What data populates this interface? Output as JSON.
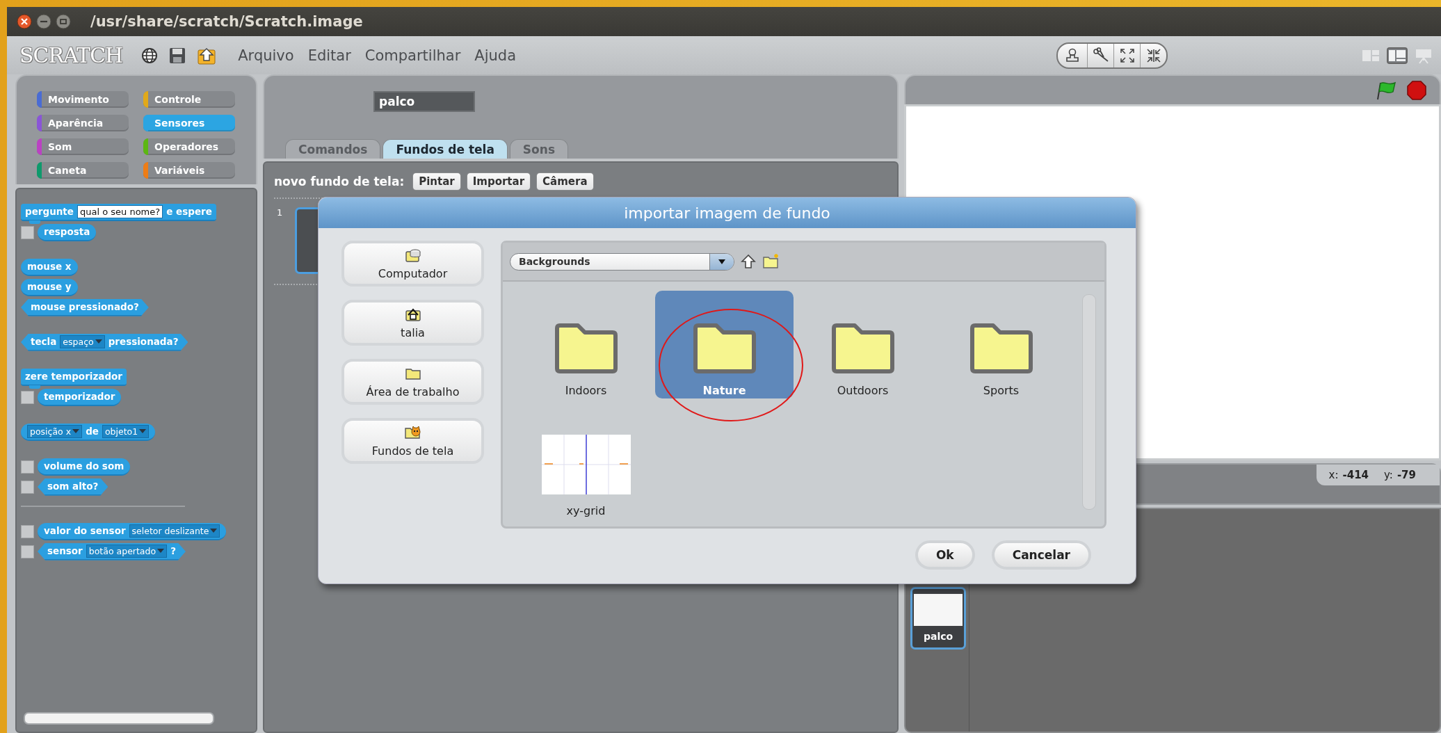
{
  "window": {
    "title": "/usr/share/scratch/Scratch.image"
  },
  "menu_bar": {
    "logo": "SCRATCH",
    "menus": [
      "Arquivo",
      "Editar",
      "Compartilhar",
      "Ajuda"
    ]
  },
  "view_modes": [
    {
      "selected": false
    },
    {
      "selected": true
    },
    {
      "selected": false
    }
  ],
  "categories": [
    {
      "label": "Movimento",
      "color": "#4a6cd4",
      "selected": false
    },
    {
      "label": "Controle",
      "color": "#e1a91a",
      "selected": false
    },
    {
      "label": "Aparência",
      "color": "#8a55d7",
      "selected": false
    },
    {
      "label": "Sensores",
      "color": "#2ca5e2",
      "selected": true
    },
    {
      "label": "Som",
      "color": "#bb42c3",
      "selected": false
    },
    {
      "label": "Operadores",
      "color": "#5cb712",
      "selected": false
    },
    {
      "label": "Caneta",
      "color": "#0e9a6c",
      "selected": false
    },
    {
      "label": "Variáveis",
      "color": "#ee7d16",
      "selected": false
    }
  ],
  "palette": {
    "groups": [
      {
        "kind": "blocks",
        "blocks": [
          {
            "kind": "command",
            "parts": [
              {
                "kind": "label",
                "text": "pergunte"
              },
              {
                "kind": "input",
                "text": "qual o seu nome?"
              },
              {
                "kind": "label",
                "text": "e espere"
              }
            ]
          },
          {
            "kind": "reporter",
            "checked": false,
            "parts": [
              {
                "kind": "label",
                "text": "resposta"
              }
            ]
          }
        ]
      },
      {
        "kind": "blocks",
        "blocks": [
          {
            "kind": "reporter",
            "parts": [
              {
                "kind": "label",
                "text": "mouse x"
              }
            ]
          },
          {
            "kind": "reporter",
            "parts": [
              {
                "kind": "label",
                "text": "mouse y"
              }
            ]
          },
          {
            "kind": "boolean",
            "parts": [
              {
                "kind": "label",
                "text": "mouse pressionado?"
              }
            ]
          }
        ]
      },
      {
        "kind": "blocks",
        "blocks": [
          {
            "kind": "boolean",
            "parts": [
              {
                "kind": "label",
                "text": "tecla"
              },
              {
                "kind": "menu",
                "text": "espaço"
              },
              {
                "kind": "label",
                "text": "pressionada?"
              }
            ]
          }
        ]
      },
      {
        "kind": "blocks",
        "blocks": [
          {
            "kind": "command",
            "parts": [
              {
                "kind": "label",
                "text": "zere temporizador"
              }
            ]
          },
          {
            "kind": "reporter",
            "checked": false,
            "parts": [
              {
                "kind": "label",
                "text": "temporizador"
              }
            ]
          }
        ]
      },
      {
        "kind": "blocks",
        "blocks": [
          {
            "kind": "reporter",
            "parts": [
              {
                "kind": "menu",
                "text": "posição x"
              },
              {
                "kind": "label",
                "text": "de"
              },
              {
                "kind": "menu",
                "text": "objeto1"
              }
            ]
          }
        ]
      },
      {
        "kind": "blocks",
        "blocks": [
          {
            "kind": "reporter",
            "checked": false,
            "parts": [
              {
                "kind": "label",
                "text": "volume do som"
              }
            ]
          },
          {
            "kind": "boolean",
            "checked": false,
            "parts": [
              {
                "kind": "label",
                "text": "som alto?"
              }
            ]
          }
        ]
      },
      {
        "kind": "separator"
      },
      {
        "kind": "blocks",
        "blocks": [
          {
            "kind": "reporter",
            "checked": false,
            "parts": [
              {
                "kind": "label",
                "text": "valor do sensor"
              },
              {
                "kind": "menu",
                "text": "seletor deslizante"
              }
            ]
          },
          {
            "kind": "boolean",
            "checked": false,
            "parts": [
              {
                "kind": "label",
                "text": "sensor"
              },
              {
                "kind": "menu",
                "text": "botão apertado"
              },
              {
                "kind": "label",
                "text": "?"
              }
            ]
          }
        ]
      }
    ]
  },
  "editor": {
    "sprite_name": "palco",
    "tabs": [
      {
        "label": "Comandos",
        "selected": false
      },
      {
        "label": "Fundos de tela",
        "selected": true
      },
      {
        "label": "Sons",
        "selected": false
      }
    ],
    "new_label": "novo fundo de tela:",
    "buttons": [
      "Pintar",
      "Importar",
      "Câmera"
    ],
    "costumes": [
      {
        "number": "1",
        "selected": true
      }
    ]
  },
  "stage": {
    "x_label": "x:",
    "x_value": "-414",
    "y_label": "y:",
    "y_value": "-79",
    "sprites": [
      {
        "name": "palco",
        "selected": true
      }
    ]
  },
  "dialog": {
    "title": "importar imagem de fundo",
    "places": [
      {
        "label": "Computador",
        "kind": "computer"
      },
      {
        "label": "talia",
        "kind": "home"
      },
      {
        "label": "Área de trabalho",
        "kind": "folder"
      },
      {
        "label": "Fundos de tela",
        "kind": "scratch"
      }
    ],
    "path": "Backgrounds",
    "items": [
      {
        "name": "Indoors",
        "kind": "folder",
        "selected": false,
        "circled": false
      },
      {
        "name": "Nature",
        "kind": "folder",
        "selected": true,
        "circled": true
      },
      {
        "name": "Outdoors",
        "kind": "folder",
        "selected": false,
        "circled": false
      },
      {
        "name": "Sports",
        "kind": "folder",
        "selected": false,
        "circled": false
      },
      {
        "name": "xy-grid",
        "kind": "image",
        "selected": false,
        "circled": false
      }
    ],
    "buttons": [
      "Ok",
      "Cancelar"
    ]
  }
}
